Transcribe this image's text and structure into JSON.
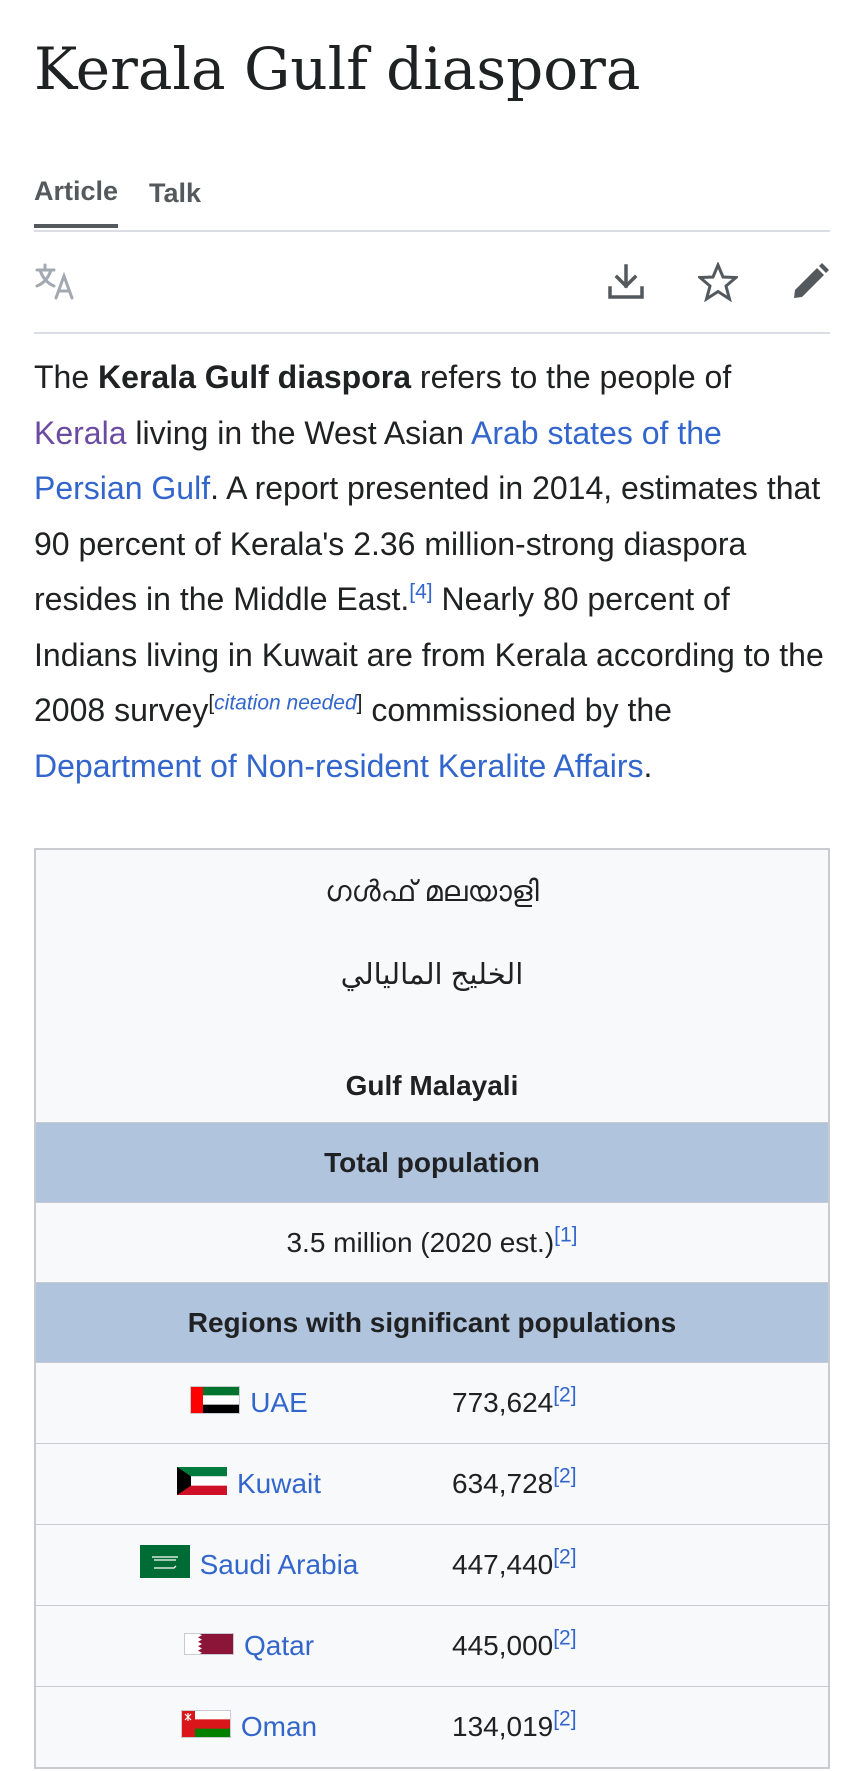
{
  "page": {
    "title": "Kerala Gulf diaspora"
  },
  "tabs": [
    {
      "label": "Article"
    },
    {
      "label": "Talk"
    }
  ],
  "lede": {
    "t1": "The ",
    "bold": "Kerala Gulf diaspora",
    "t2": " refers to the people of ",
    "link_kerala": "Kerala",
    "t3": " living in the West Asian ",
    "link_arab": "Arab states of the Persian Gulf",
    "t4": ". A report presented in 2014, estimates that 90 percent of Kerala's 2.36 million-strong diaspora resides in the Middle East.",
    "ref4": "[4]",
    "t5": " Nearly 80 percent of Indians living in Kuwait are from Kerala according to the 2008 survey",
    "cn_open": "[",
    "cn_text": "citation needed",
    "cn_close": "]",
    "t6": " commissioned by the ",
    "link_dept": "Department of Non-resident Keralite Affairs",
    "t7": "."
  },
  "infobox": {
    "name_ml": "ഗൾഫ് മലയാളി",
    "name_ar": "الخليج الماليالي",
    "name_en": "Gulf Malayali",
    "total_header": "Total population",
    "total_value": "3.5 million (2020 est.)",
    "total_ref": "[1]",
    "regions_header": "Regions with significant populations",
    "regions": [
      {
        "country": "UAE",
        "value": "773,624",
        "ref": "[2]",
        "flag": "uae-flag-icon"
      },
      {
        "country": "Kuwait",
        "value": "634,728",
        "ref": "[2]",
        "flag": "kuwait-flag-icon"
      },
      {
        "country": "Saudi Arabia",
        "value": "447,440",
        "ref": "[2]",
        "flag": "saudi-flag-icon"
      },
      {
        "country": "Qatar",
        "value": "445,000",
        "ref": "[2]",
        "flag": "qatar-flag-icon"
      },
      {
        "country": "Oman",
        "value": "134,019",
        "ref": "[2]",
        "flag": "oman-flag-icon"
      }
    ]
  },
  "icons": {
    "language": "language-icon",
    "download": "download-icon",
    "watch": "star-icon",
    "edit": "pencil-icon"
  },
  "colors": {
    "link": "#3366cc",
    "visited_link": "#6b4ba1",
    "infobox_header_bg": "#b0c4de",
    "infobox_bg": "#f8f9fa"
  }
}
